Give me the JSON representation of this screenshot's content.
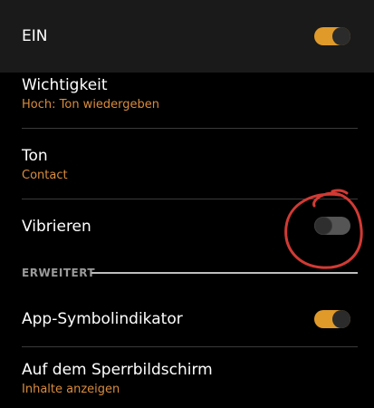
{
  "master": {
    "label": "EIN",
    "enabled": true
  },
  "settings": [
    {
      "title": "Wichtigkeit",
      "subtitle": "Hoch: Ton wiedergeben"
    },
    {
      "title": "Ton",
      "subtitle": "Contact"
    },
    {
      "title": "Vibrieren",
      "enabled": false
    }
  ],
  "advanced": {
    "header": "ERWEITERT",
    "items": [
      {
        "title": "App-Symbolindikator",
        "enabled": true
      },
      {
        "title": "Auf dem Sperrbildschirm",
        "subtitle": "Inhalte anzeigen"
      }
    ]
  },
  "colors": {
    "accent": "#e09a2a",
    "subtitle": "#d98c3e",
    "annotation": "#d23a34"
  }
}
